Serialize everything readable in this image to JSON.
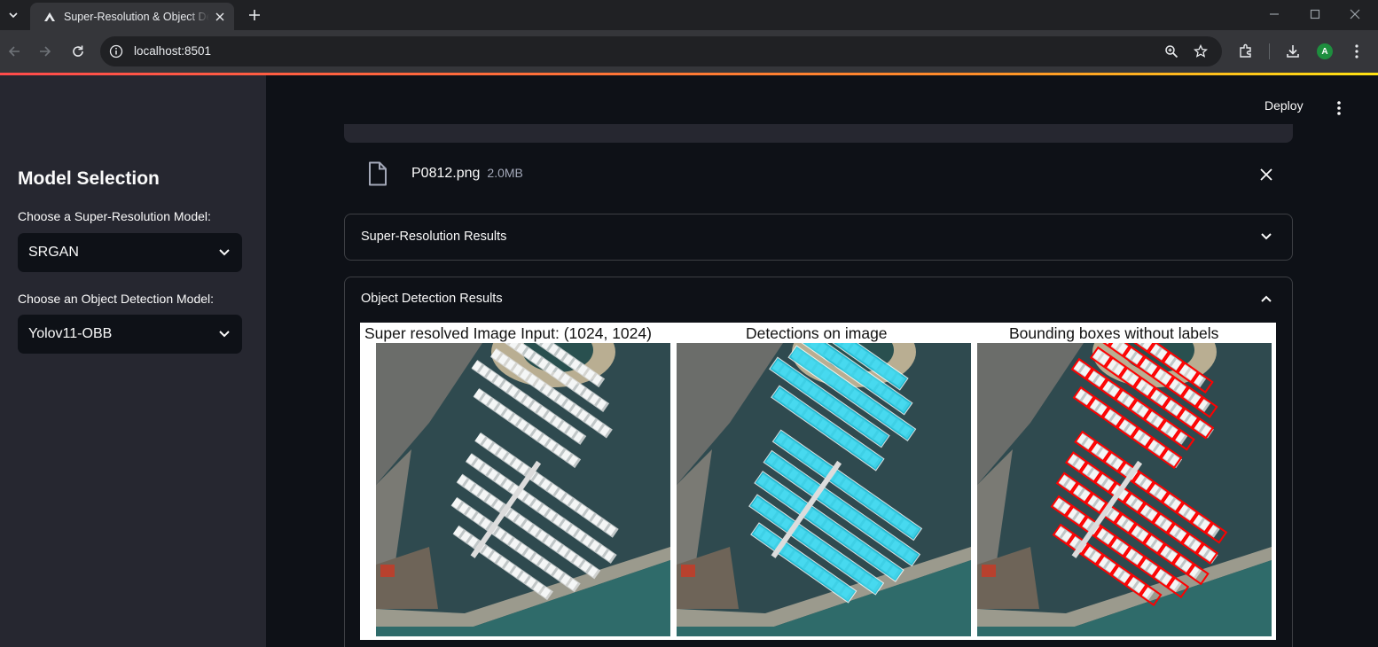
{
  "browser": {
    "tab_title": "Super-Resolution & Object Detection",
    "url": "localhost:8501",
    "profile_initial": "A"
  },
  "app": {
    "deploy_label": "Deploy",
    "sidebar": {
      "title": "Model Selection",
      "sr_label": "Choose a Super-Resolution Model:",
      "sr_value": "SRGAN",
      "od_label": "Choose an Object Detection Model:",
      "od_value": "Yolov11-OBB"
    },
    "file": {
      "name": "P0812.png",
      "size": "2.0MB"
    },
    "expanders": {
      "sr_results": "Super-Resolution Results",
      "od_results": "Object Detection Results"
    },
    "figure": {
      "titles": [
        "Super resolved Image Input: (1024, 1024)",
        "Detections on image",
        "Bounding boxes without labels"
      ]
    }
  },
  "icons": [
    "chevron-down-icon",
    "chrome-tab-favicon",
    "close-icon",
    "plus-icon",
    "minimize-icon",
    "maximize-icon",
    "back-arrow-icon",
    "forward-arrow-icon",
    "reload-icon",
    "info-icon",
    "zoom-icon",
    "star-icon",
    "extensions-icon",
    "download-icon",
    "kebab-menu-icon",
    "file-icon",
    "chevron-up-icon"
  ],
  "colors": {
    "streamlit_bg": "#0e1117",
    "sidebar_bg": "#262730",
    "detection_box_cyan": "#22d3ee",
    "detection_box_red": "#ff0000"
  }
}
